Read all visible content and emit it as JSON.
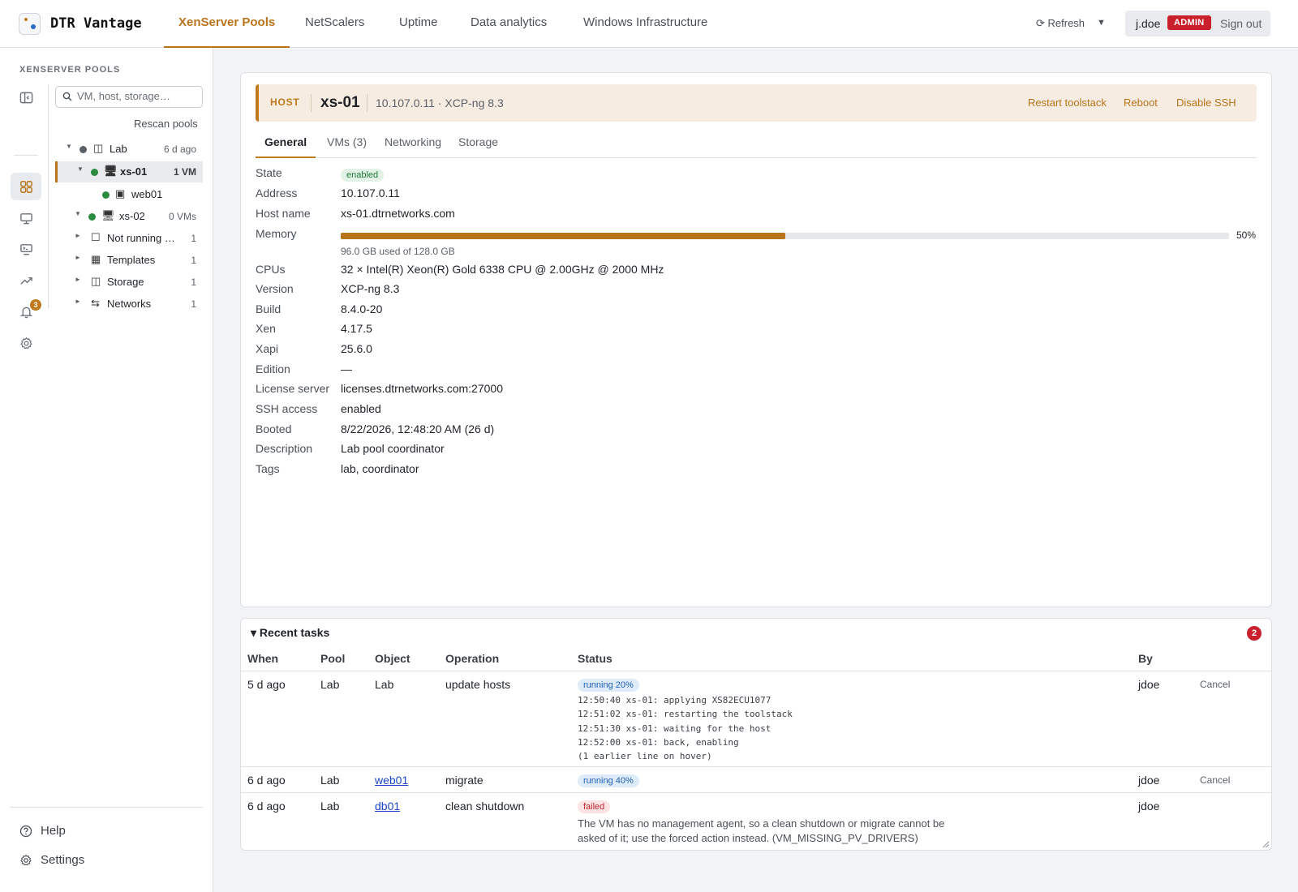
{
  "app": {
    "title": "DTR Vantage"
  },
  "nav": {
    "tabs": [
      "XenServer Pools",
      "NetScalers",
      "Uptime",
      "Data analytics",
      "Windows Infrastructure"
    ],
    "active_index": 0
  },
  "header": {
    "refresh_label": "⟳ Refresh",
    "refresh_caret": "▼",
    "username": "j.doe",
    "role_badge": "ADMIN",
    "signout_label": "Sign out"
  },
  "sidebar": {
    "title": "XENSERVER POOLS",
    "search_placeholder": "VM, host, storage…",
    "rescan_label": "Rescan pools",
    "notification_count": "3",
    "tree": [
      {
        "label": "Lab",
        "meta": "6 d ago",
        "icon": "▢",
        "caret": "▼",
        "status": "grey"
      },
      {
        "label": "xs-01",
        "meta": "1 VM",
        "icon": "🖥",
        "caret": "▼",
        "status": "green",
        "selected": true
      },
      {
        "label": "web01",
        "meta": "",
        "icon": "▣",
        "caret": "",
        "status": "green"
      },
      {
        "label": "xs-02",
        "meta": "0 VMs",
        "icon": "🖥",
        "caret": "▼",
        "status": "green"
      },
      {
        "label": "Not running …",
        "meta": "1",
        "icon": "☐",
        "caret": "►"
      },
      {
        "label": "Templates",
        "meta": "1",
        "icon": "▦",
        "caret": "►"
      },
      {
        "label": "Storage",
        "meta": "1",
        "icon": "◫",
        "caret": "►"
      },
      {
        "label": "Networks",
        "meta": "1",
        "icon": "⇆",
        "caret": "►"
      }
    ],
    "help_label": "Help",
    "settings_label": "Settings"
  },
  "host": {
    "tag": "HOST",
    "name": "xs-01",
    "address_summary": "10.107.0.11 · XCP-ng 8.3",
    "actions": [
      "Restart toolstack",
      "Reboot",
      "Disable SSH"
    ],
    "tabs": [
      "General",
      "VMs (3)",
      "Networking",
      "Storage"
    ],
    "active_tab": 0,
    "state_label": "State",
    "state_value": "enabled",
    "address_label": "Address",
    "address_value": "10.107.0.11",
    "hostname_label": "Host name",
    "hostname_value": "xs-01.dtrnetworks.com",
    "memory_label": "Memory",
    "memory_fraction": 0.5,
    "memory_percent": "50%",
    "memory_sub": "96.0 GB used of 128.0 GB",
    "cpus_label": "CPUs",
    "cpus_value": "32 × Intel(R) Xeon(R) Gold 6338 CPU @ 2.00GHz @ 2000 MHz",
    "version_label": "Version",
    "version_value": "XCP-ng 8.3",
    "build_label": "Build",
    "build_value": "8.4.0-20",
    "xen_label": "Xen",
    "xen_value": "4.17.5",
    "xapi_label": "Xapi",
    "xapi_value": "25.6.0",
    "edition_label": "Edition",
    "edition_value": "—",
    "license_label": "License server",
    "license_value": "licenses.dtrnetworks.com:27000",
    "ssh_label": "SSH access",
    "ssh_value": "enabled",
    "booted_label": "Booted",
    "booted_value": "8/22/2026, 12:48:20 AM (26 d)",
    "description_label": "Description",
    "description_value": "Lab pool coordinator",
    "tags_label": "Tags",
    "tags_value": "lab, coordinator"
  },
  "tasks": {
    "title": "▾ Recent tasks",
    "count": "2",
    "columns": [
      "When",
      "Pool",
      "Object",
      "Operation",
      "Status",
      "By"
    ],
    "rows": [
      {
        "when": "5 d ago",
        "pool": "Lab",
        "object": "Lab",
        "operation": "update hosts",
        "status": "running 20%",
        "by": "jdoe",
        "action": "Cancel",
        "log": "12:50:40 xs-01: applying XS82ECU1077\n12:51:02 xs-01: restarting the toolstack\n12:51:30 xs-01: waiting for the host\n12:52:00 xs-01: back, enabling\n(1 earlier line on hover)"
      },
      {
        "when": "6 d ago",
        "pool": "Lab",
        "object": "web01",
        "operation": "migrate",
        "status": "running 40%",
        "by": "jdoe",
        "action": "Cancel"
      },
      {
        "when": "6 d ago",
        "pool": "Lab",
        "object": "db01",
        "operation": "clean shutdown",
        "status": "failed",
        "by": "jdoe",
        "message": "The VM has no management agent, so a clean shutdown or migrate cannot be asked of it; use the forced action instead. (VM_MISSING_PV_DRIVERS)"
      }
    ]
  },
  "colors": {
    "accent": "#b8741a",
    "admin_badge": "#c9202b",
    "status_green": "#2a8a3e",
    "status_grey": "#5b6169"
  }
}
